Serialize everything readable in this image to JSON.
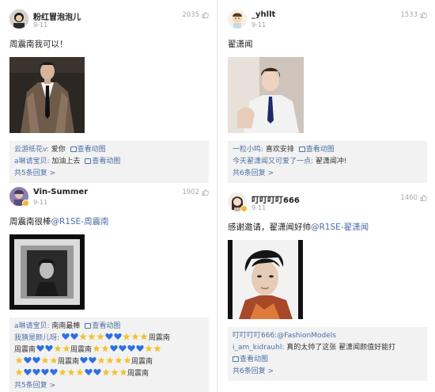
{
  "cards": [
    {
      "username": "粉红冒泡泡儿",
      "date": "9-11",
      "likes": "2035",
      "content": "周震南我可以！",
      "replies": [
        {
          "name": "云游纸花v:",
          "text": " 爱你",
          "pic": "查看动图"
        },
        {
          "name": "a琳请宝贝:",
          "text": " 加油上去",
          "pic": "查看动图"
        }
      ],
      "more": "共5条回复 >"
    },
    {
      "username": "_yhllt",
      "date": "9-11",
      "likes": "1533",
      "content": "翟潇闻",
      "replies": [
        {
          "name": "一粒小鸣:",
          "text": " 喜欢安排",
          "pic": "查看动图"
        },
        {
          "name": "今天翟潇闻又可爱了一点:",
          "text": " 翟潇闻冲!",
          "pic": ""
        }
      ],
      "more": "共6条回复 >"
    },
    {
      "username": "Vin-Summer",
      "date": "9-11",
      "likes": "1902",
      "content": "周震南很棒",
      "mention": "@R1SE-周震南",
      "replies": [
        {
          "name": "a琳请宝贝:",
          "text": " 南南最棒",
          "pic": "查看动图"
        },
        {
          "name": "我猜是颜儿呀:",
          "text": "",
          "pic": ""
        }
      ],
      "emoji_text": "周震南",
      "more": "共5条回复 >"
    },
    {
      "username": "叮叮叮叮666",
      "date": "9-11",
      "likes": "1460",
      "content": "感谢邀请，翟潇闻好帅",
      "mention": "@R1SE-翟潇闻",
      "replies": [
        {
          "name": "叮叮叮叮666:",
          "text": "",
          "mention": "@FashionModels",
          "pic": ""
        },
        {
          "name": "i_am_kidrauhl:",
          "text": " 真的太帅了这张 翟潇闻颜值好能打",
          "pic": "查看动图"
        }
      ],
      "more": "共6条回复 >"
    }
  ],
  "icons": {
    "like": "thumbs-up-icon",
    "pic": "image-icon",
    "heart": "blue-heart-emoji",
    "star": "star-emoji"
  },
  "colors": {
    "link": "#4d6fa6",
    "reply_bg": "#f2f2f2",
    "heart": "#2f6fe0",
    "star": "#f2c230"
  }
}
